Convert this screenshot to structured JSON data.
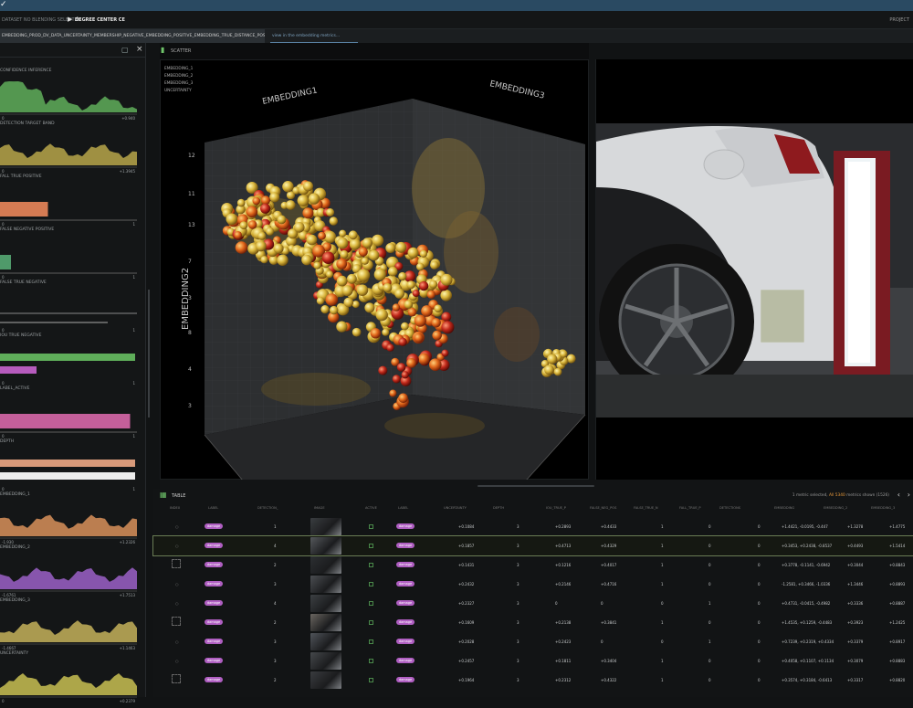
{
  "app": {
    "breadcrumb": "DATASET NO BLENDING SELECTED",
    "current": "DEGREE CENTER CE",
    "right_label": "PROJECT",
    "tab_primary": "EMBEDDING_PROD_DV_DATA_UNCERTAINTY_MEMBERSHIP_NEGATIVE_EMBEDDING_POSITIVE_EMBEDDING_TRUE_DISTANCE_POS",
    "tab_secondary": "view in the embedding metrics..."
  },
  "sidebar": {
    "filters": [
      {
        "title": "CONFIDENCE INFERENCE",
        "left": "0",
        "right": "+0.940"
      },
      {
        "title": "DETECTION TARGET BAND",
        "left": "0",
        "right": "+1.3945"
      },
      {
        "title": "FALL TRUE POSITIVE",
        "left": "0",
        "right": "1"
      },
      {
        "title": "FALSE NEGATIVE POSITIVE",
        "left": "0",
        "right": "1"
      },
      {
        "title": "FALSE TRUE NEGATIVE",
        "left": "0",
        "right": "1"
      },
      {
        "title": "IOU TRUE NEGATIVE",
        "left": "0",
        "right": "1"
      },
      {
        "title": "LABEL_ACTIVE",
        "left": "0",
        "right": "1"
      },
      {
        "title": "DEPTH",
        "left": "0",
        "right": "1"
      },
      {
        "title": "EMBEDDING_1",
        "left": "-1.930",
        "right": "+1.2326"
      },
      {
        "title": "EMBEDDING_2",
        "left": "-1.6761",
        "right": "+1.7513"
      },
      {
        "title": "EMBEDDING_3",
        "left": "-1.4667",
        "right": "+1.1463"
      },
      {
        "title": "UNCERTAINTY",
        "left": "0",
        "right": "+0.2379"
      }
    ]
  },
  "viz": {
    "title": "SCATTER",
    "legend": [
      "EMBEDDING_1",
      "EMBEDDING_2",
      "EMBEDDING_3",
      "UNCERTAINTY"
    ],
    "axis1": "EMBEDDING1",
    "axis2": "EMBEDDING2",
    "axis3": "EMBEDDING3",
    "ticks": [
      "12",
      "11",
      "13",
      "7",
      "3",
      "8",
      "4",
      "3"
    ]
  },
  "table": {
    "title": "TABLE",
    "stat_prefix": "1 metric selected,",
    "stat_count": "All 5340",
    "stat_suffix": "metrics shown (1526)",
    "columns": [
      "INDEX",
      "LABEL",
      "DETECTION_",
      "IMAGE",
      "ACTIVE",
      "LABEL",
      "UNCERTAINTY",
      "DEPTH",
      "IOU_TRUE_P",
      "FALSE_NEG_POS",
      "FALSE_TRUE_N",
      "FALL_TRUE_P",
      "DETECTIONS",
      "EMBEDDING",
      "EMBEDDING_2",
      "EMBEDDING_3"
    ],
    "rows": [
      {
        "n": "1",
        "pill": "damage",
        "pill2": "damage",
        "u": "+0.1084",
        "d": "3",
        "a": "+0.2893",
        "b": "+0.4433",
        "c": "1",
        "e": "0",
        "f": "0",
        "g": "+1.4421, -0.0195, -0.447",
        "h": "+1.3278",
        "i": "+1.4775"
      },
      {
        "n": "4",
        "pill": "damage",
        "pill2": "damage",
        "u": "+0.1857",
        "d": "3",
        "a": "+0.4713",
        "b": "+0.4329",
        "c": "1",
        "e": "0",
        "f": "0",
        "g": "+0.3453, +0.2438, -0.8537",
        "h": "+0.4493",
        "i": "+1.5414"
      },
      {
        "n": "2",
        "pill": "damage",
        "pill2": "damage",
        "u": "+0.1431",
        "d": "3",
        "a": "+0.1216",
        "b": "+0.4017",
        "c": "1",
        "e": "0",
        "f": "0",
        "g": "+0.3778, -0.1141, -0.6942",
        "h": "+0.3044",
        "i": "+0.8843"
      },
      {
        "n": "3",
        "pill": "damage",
        "pill2": "damage",
        "u": "+0.2432",
        "d": "3",
        "a": "+0.2146",
        "b": "+0.4716",
        "c": "1",
        "e": "0",
        "f": "0",
        "g": "-1.2581, +0.3466, -1.0336",
        "h": "+1.3446",
        "i": "+0.8893"
      },
      {
        "n": "4",
        "pill": "damage",
        "pill2": "damage",
        "u": "+0.2327",
        "d": "3",
        "a": "0",
        "b": "0",
        "c": "0",
        "e": "1",
        "f": "0",
        "g": "+0.4731, -0.0415, -0.4982",
        "h": "+0.3336",
        "i": "+0.8887"
      },
      {
        "n": "2",
        "pill": "damage",
        "pill2": "damage",
        "u": "+0.1609",
        "d": "3",
        "a": "+0.2138",
        "b": "+0.3841",
        "c": "1",
        "e": "0",
        "f": "0",
        "g": "+1.4535, +0.1259, -0.4483",
        "h": "+0.3923",
        "i": "+1.2425"
      },
      {
        "n": "3",
        "pill": "damage",
        "pill2": "damage",
        "u": "+0.2028",
        "d": "3",
        "a": "+0.2423",
        "b": "0",
        "c": "0",
        "e": "1",
        "f": "0",
        "g": "+0.7239, +0.2319, +0.4334",
        "h": "+0.3379",
        "i": "+0.8917"
      },
      {
        "n": "3",
        "pill": "damage",
        "pill2": "damage",
        "u": "+0.2457",
        "d": "3",
        "a": "+0.1811",
        "b": "+0.3404",
        "c": "1",
        "e": "0",
        "f": "0",
        "g": "+0.4058, +0.1107, +0.1134",
        "h": "+0.3079",
        "i": "+0.8883"
      },
      {
        "n": "2",
        "pill": "damage",
        "pill2": "damage",
        "u": "+0.1964",
        "d": "3",
        "a": "+0.2312",
        "b": "+0.4322",
        "c": "1",
        "e": "0",
        "f": "0",
        "g": "+0.3574, +0.3184, -0.6413",
        "h": "+0.3317",
        "i": "+0.8820"
      }
    ]
  },
  "colors": {
    "accent_green": "#6fc46a",
    "pill": "#b05fc2",
    "orange": "#e89a3b"
  }
}
